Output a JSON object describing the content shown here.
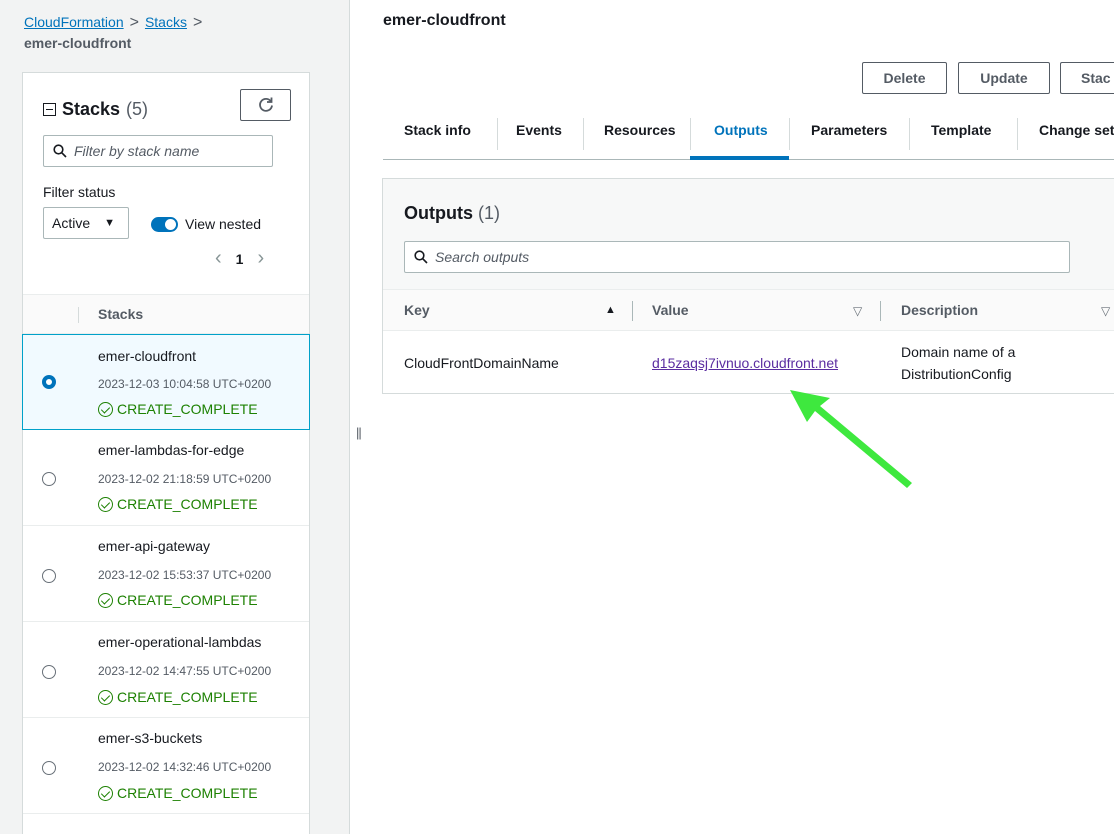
{
  "breadcrumb": {
    "items": [
      "CloudFormation",
      "Stacks"
    ],
    "separator": ">",
    "current": "emer-cloudfront"
  },
  "sidebar": {
    "title": "Stacks",
    "count": "(5)",
    "filter_placeholder": "Filter by stack name",
    "filter_status_label": "Filter status",
    "status_value": "Active",
    "view_nested_label": "View nested",
    "page": "1",
    "column_header": "Stacks",
    "stacks": [
      {
        "name": "emer-cloudfront",
        "date": "2023-12-03 10:04:58 UTC+0200",
        "status": "CREATE_COMPLETE",
        "selected": true
      },
      {
        "name": "emer-lambdas-for-edge",
        "date": "2023-12-02 21:18:59 UTC+0200",
        "status": "CREATE_COMPLETE",
        "selected": false
      },
      {
        "name": "emer-api-gateway",
        "date": "2023-12-02 15:53:37 UTC+0200",
        "status": "CREATE_COMPLETE",
        "selected": false
      },
      {
        "name": "emer-operational-lambdas",
        "date": "2023-12-02 14:47:55 UTC+0200",
        "status": "CREATE_COMPLETE",
        "selected": false
      },
      {
        "name": "emer-s3-buckets",
        "date": "2023-12-02 14:32:46 UTC+0200",
        "status": "CREATE_COMPLETE",
        "selected": false
      }
    ]
  },
  "main": {
    "title": "emer-cloudfront",
    "actions": [
      "Delete",
      "Update",
      "Stac"
    ],
    "tabs": [
      "Stack info",
      "Events",
      "Resources",
      "Outputs",
      "Parameters",
      "Template",
      "Change set"
    ],
    "active_tab": "Outputs",
    "outputs": {
      "title": "Outputs",
      "count": "(1)",
      "search_placeholder": "Search outputs",
      "columns": [
        "Key",
        "Value",
        "Description"
      ],
      "rows": [
        {
          "key": "CloudFrontDomainName",
          "value": "d15zaqsj7ivnuo.cloudfront.net",
          "description_line1": "Domain name of a",
          "description_line2": "DistributionConfig"
        }
      ]
    }
  },
  "colors": {
    "accent": "#0073bb",
    "success": "#1d8102",
    "annotation_arrow": "#3ee83e",
    "visited_link": "#5a2ca0"
  }
}
